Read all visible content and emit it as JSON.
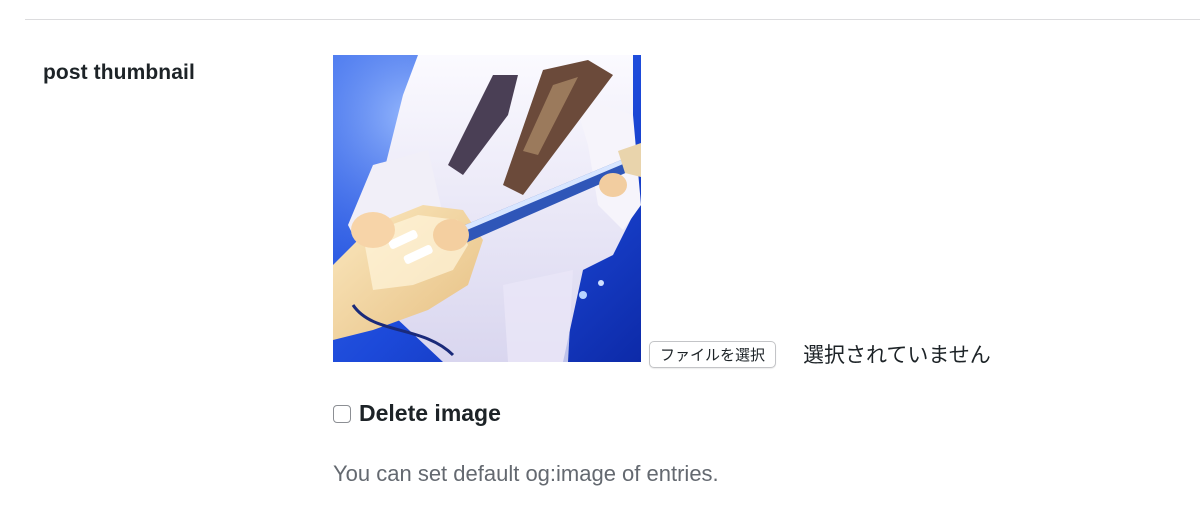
{
  "field": {
    "label": "post thumbnail"
  },
  "thumbnail": {
    "alt": "Guitarist playing electric guitar on stage"
  },
  "file_input": {
    "button_label": "ファイルを選択",
    "status": "選択されていません"
  },
  "delete_image": {
    "label": "Delete image",
    "checked": false
  },
  "help": {
    "text": "You can set default og:image of entries."
  },
  "colors": {
    "stage_blue": "#1f4fd6",
    "shirt_white": "#f3f1f6",
    "guitar_cream": "#f0d8a8",
    "help_gray": "#646970"
  }
}
